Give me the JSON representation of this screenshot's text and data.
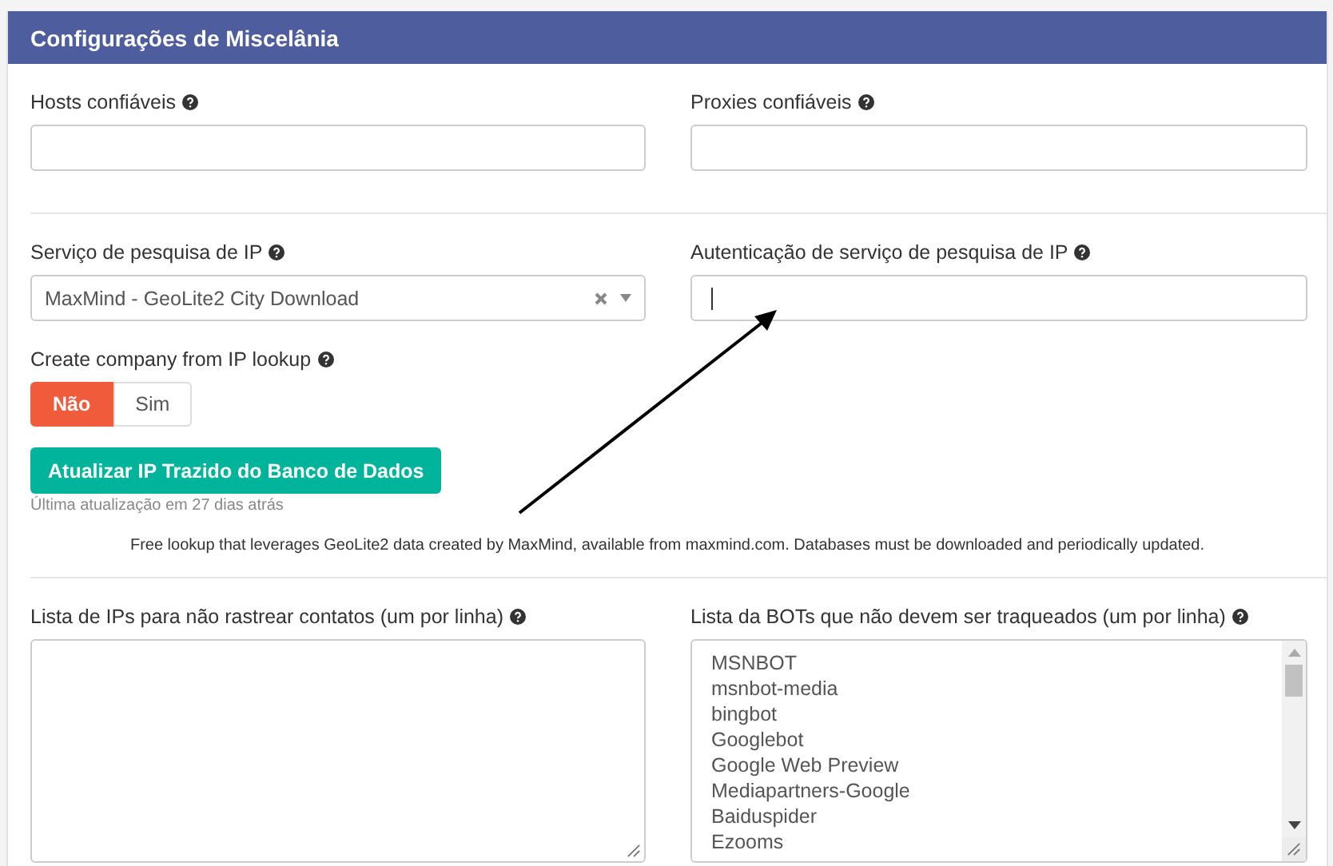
{
  "panel": {
    "title": "Configurações de Miscelânia"
  },
  "row_1": [
    {
      "label": "Hosts confiáveis"
    },
    {
      "label": "Proxies confiáveis"
    }
  ],
  "ip_service": {
    "label": "Serviço de pesquisa de IP",
    "value": "MaxMind - GeoLite2 City Download"
  },
  "ip_auth": {
    "label": "Autenticação de serviço de pesquisa de IP",
    "focused": true
  },
  "create_company": {
    "label": "Create company from IP lookup",
    "options": [
      {
        "label": "Não",
        "selected": true
      },
      {
        "label": "Sim",
        "selected": false
      }
    ]
  },
  "update_button": {
    "label": "Atualizar IP Trazido do Banco de Dados",
    "note": "Última atualização em 27 dias atrás"
  },
  "service_note": "Free lookup that leverages GeoLite2 data created by MaxMind, available from maxmind.com. Databases must be downloaded and periodically updated.",
  "ip_list": {
    "label": "Lista de IPs para não rastrear contatos (um por linha)"
  },
  "bot_list": {
    "label": "Lista da BOTs que não devem ser traqueados (um por linha)",
    "lines": [
      "MSNBOT",
      "msnbot-media",
      "bingbot",
      "Googlebot",
      "Google Web Preview",
      "Mediapartners-Google",
      "Baiduspider",
      "Ezooms"
    ]
  }
}
